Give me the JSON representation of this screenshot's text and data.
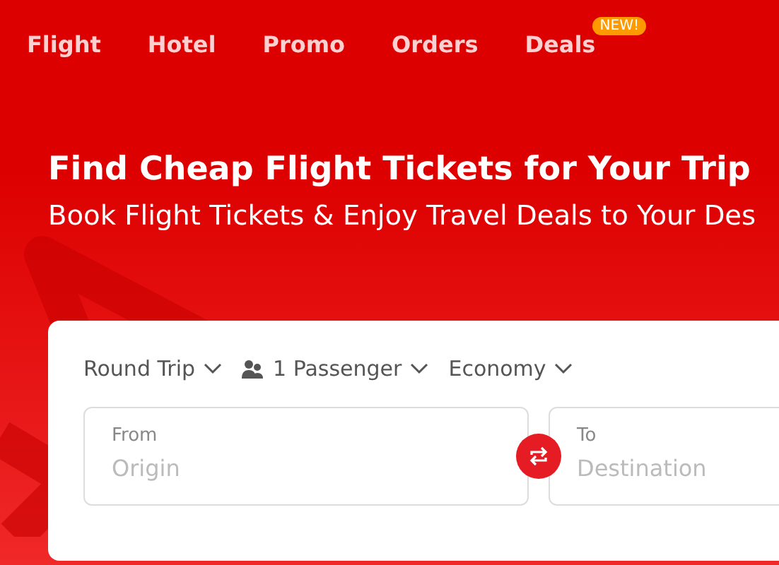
{
  "nav": [
    {
      "label": "Flight"
    },
    {
      "label": "Hotel"
    },
    {
      "label": "Promo"
    },
    {
      "label": "Orders"
    },
    {
      "label": "Deals",
      "badge": "NEW!"
    }
  ],
  "hero": {
    "title": "Find Cheap Flight Tickets for Your Trip",
    "subtitle": "Book Flight Tickets & Enjoy Travel Deals to Your Des"
  },
  "search": {
    "options": [
      {
        "kind": "plain",
        "label": "Round Trip"
      },
      {
        "kind": "passenger",
        "label": "1 Passenger"
      },
      {
        "kind": "plain",
        "label": "Economy"
      }
    ],
    "fields": [
      {
        "label": "From",
        "placeholder": "Origin"
      },
      {
        "label": "To",
        "placeholder": "Destination"
      }
    ]
  }
}
